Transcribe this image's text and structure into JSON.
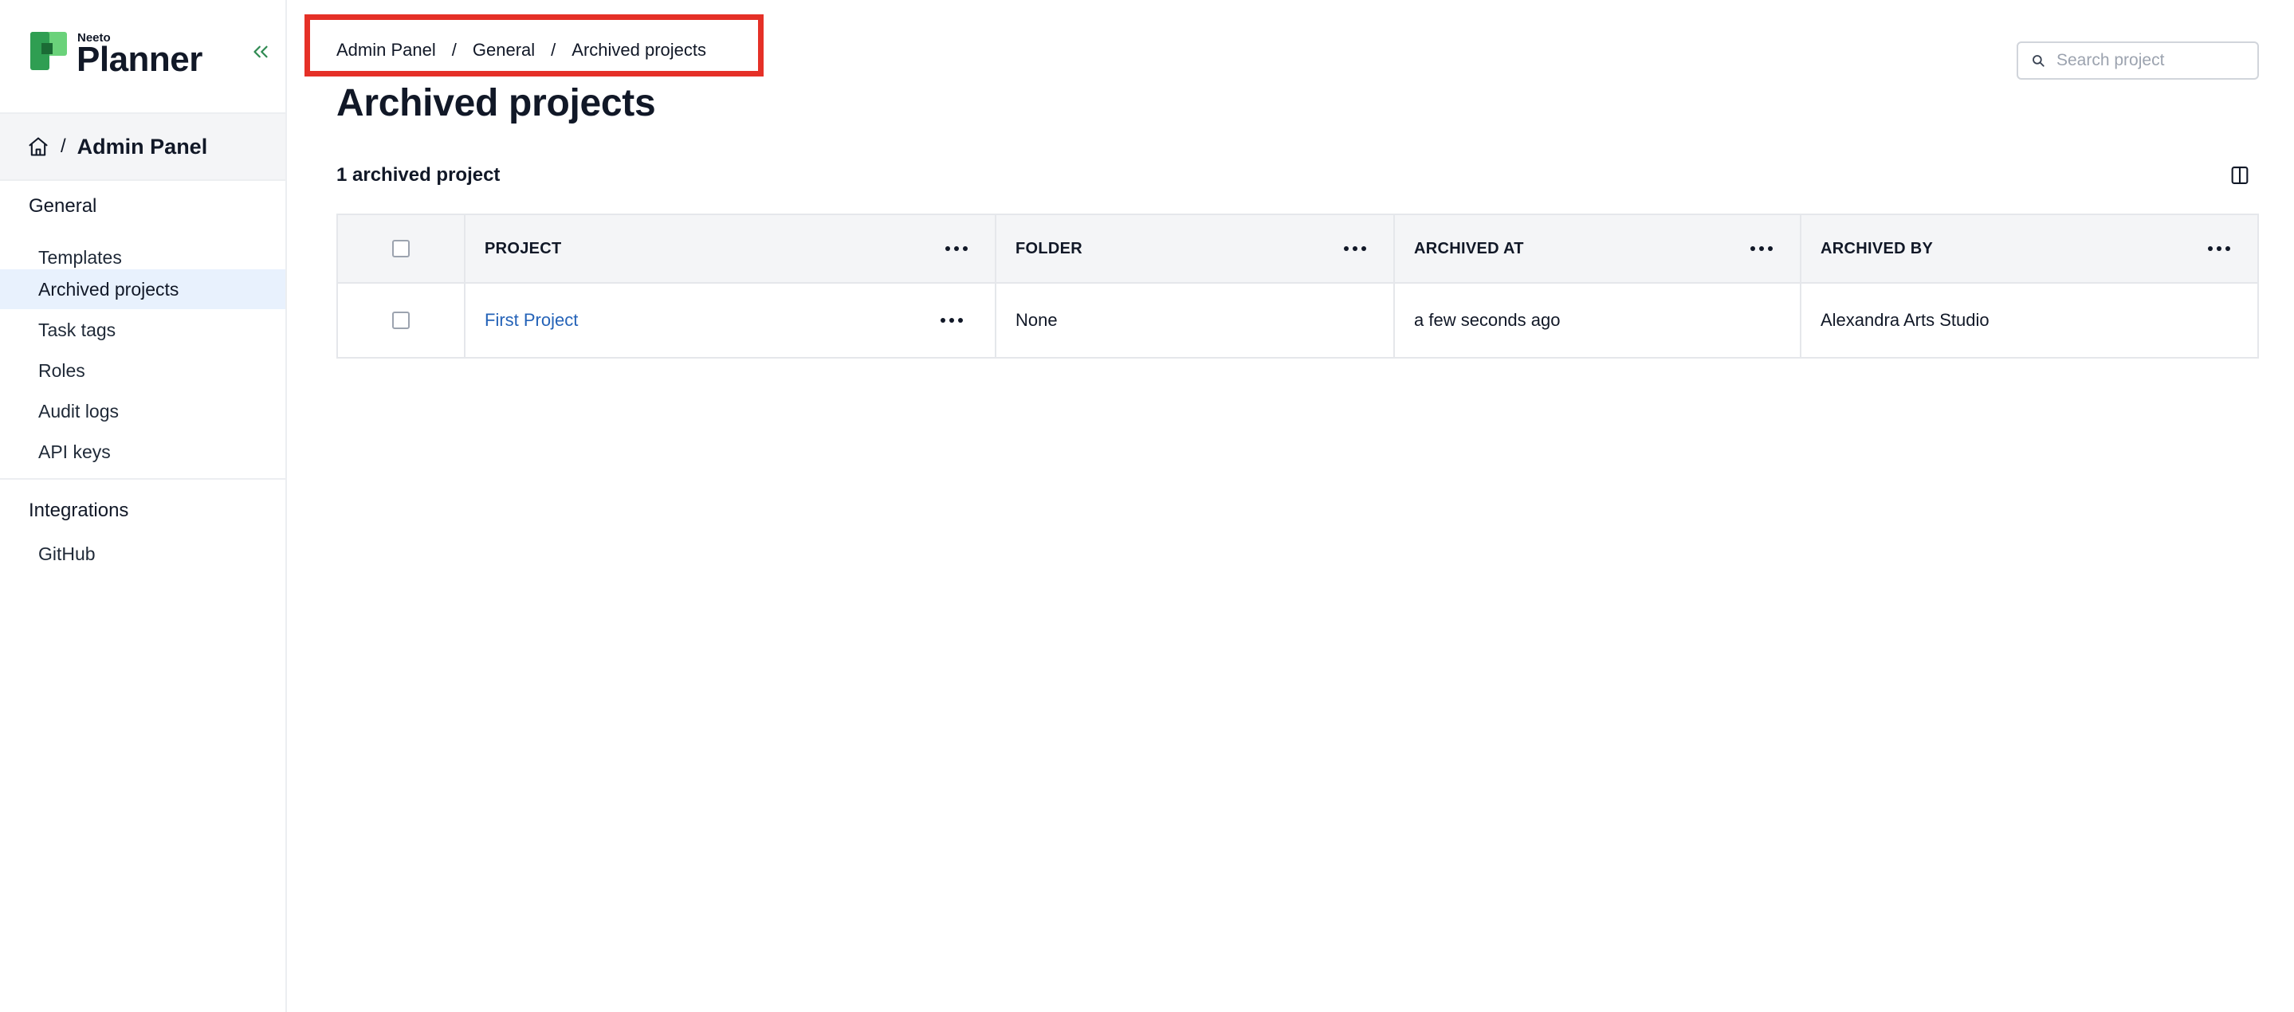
{
  "app": {
    "logo_small": "Neeto",
    "logo_main": "Planner"
  },
  "sidebar": {
    "crumb_title": "Admin Panel",
    "crumb_sep": "/",
    "sections": [
      {
        "heading": "General",
        "items": [
          {
            "label": "Templates"
          },
          {
            "label": "Archived projects",
            "active": true
          },
          {
            "label": "Task tags"
          },
          {
            "label": "Roles"
          },
          {
            "label": "Audit logs"
          },
          {
            "label": "API keys"
          }
        ]
      },
      {
        "heading": "Integrations",
        "items": [
          {
            "label": "GitHub"
          }
        ]
      }
    ]
  },
  "breadcrumb": {
    "items": [
      "Admin Panel",
      "General",
      "Archived projects"
    ],
    "sep": "/"
  },
  "page": {
    "title": "Archived projects",
    "count": "1 archived project"
  },
  "search": {
    "placeholder": "Search project",
    "value": ""
  },
  "table": {
    "columns": [
      "PROJECT",
      "FOLDER",
      "ARCHIVED AT",
      "ARCHIVED BY"
    ],
    "rows": [
      {
        "project": "First Project",
        "folder": "None",
        "archived_at": "a few seconds ago",
        "archived_by": "Alexandra Arts Studio"
      }
    ]
  },
  "colors": {
    "accent_green": "#2f8a52",
    "link_blue": "#2563b8",
    "highlight_red": "#e53027",
    "active_bg": "#e8f1fd"
  },
  "icons": {
    "collapse": "chevrons-left-icon",
    "home": "home-icon",
    "search": "search-icon",
    "columns": "columns-icon",
    "more": "more-horizontal-icon"
  }
}
